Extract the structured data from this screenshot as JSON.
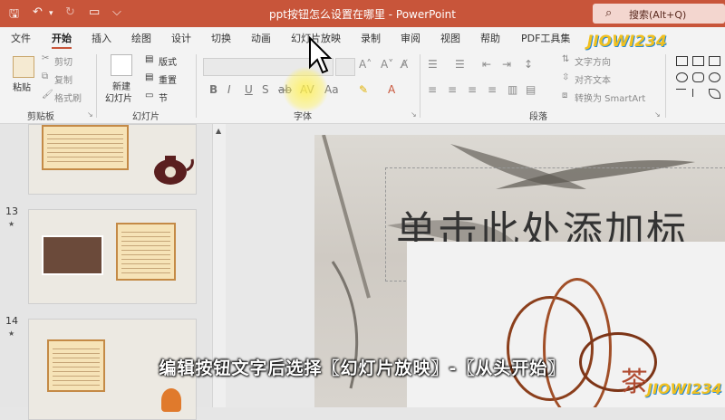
{
  "window": {
    "title": "ppt按钮怎么设置在哪里 - PowerPoint"
  },
  "search": {
    "placeholder": "搜索(Alt+Q)"
  },
  "tabs": [
    "文件",
    "开始",
    "插入",
    "绘图",
    "设计",
    "切换",
    "动画",
    "幻灯片放映",
    "录制",
    "审阅",
    "视图",
    "帮助",
    "PDF工具集"
  ],
  "active_tab": "开始",
  "ribbon": {
    "clipboard": {
      "paste": "粘贴",
      "cut": "剪切",
      "copy": "复制",
      "format_painter": "格式刷",
      "label": "剪贴板"
    },
    "slides": {
      "new_slide_line1": "新建",
      "new_slide_line2": "幻灯片",
      "layout": "版式",
      "reset": "重置",
      "section": "节",
      "label": "幻灯片"
    },
    "font": {
      "label": "字体"
    },
    "paragraph": {
      "text_direction": "文字方向",
      "align_text": "对齐文本",
      "smartart": "转换为 SmartArt",
      "label": "段落"
    }
  },
  "thumbnails": [
    {
      "number": "13",
      "star": "★"
    },
    {
      "number": "14",
      "star": "★"
    }
  ],
  "slide": {
    "title_placeholder": "单击此处添加标"
  },
  "caption": "编辑按钮文字后选择〖幻灯片放映〗-〖从头开始〗",
  "watermark": "JIOWI234",
  "colors": {
    "title_bar": "#c8553a",
    "accent": "#c8553a"
  }
}
